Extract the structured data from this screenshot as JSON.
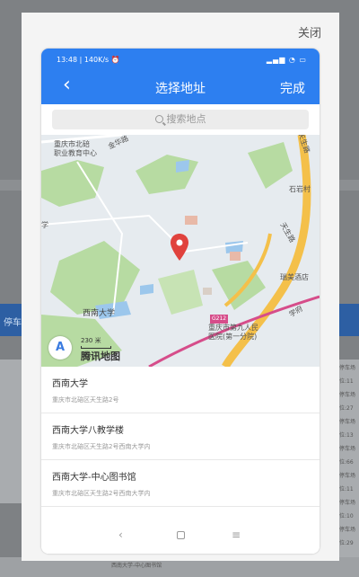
{
  "modal": {
    "close_label": "关闭"
  },
  "statusbar": {
    "time": "13:48 | 140K/s ⏰",
    "signal": "▂▄▆ ◔ ▭"
  },
  "navbar": {
    "back_icon": "‹",
    "title": "选择地址",
    "done_label": "完成"
  },
  "search": {
    "placeholder": "搜索地点"
  },
  "map": {
    "labels": {
      "school1": "重庆市北碚",
      "school2": "职业教育中心",
      "jinsheng": "金华路",
      "tiansheng1": "天生路",
      "shiyan": "石岩村",
      "tiansheng2": "天生路",
      "rui": "瑞美酒店",
      "univ": "西南大学",
      "hospital1": "重庆市第九人民",
      "hospital2": "医院(第一分院)",
      "road_badge": "G212",
      "xuemei": "学府",
      "xiao": "学",
      "scale": "230 米",
      "logo": "腾讯地图",
      "compass": "A"
    },
    "colors": {
      "water": "#9cc7ec",
      "green": "#b7dba2",
      "road": "#f4c04a",
      "road_line": "#d64d8a",
      "pin": "#e0423d"
    }
  },
  "results": [
    {
      "name": "西南大学",
      "address": "重庆市北碚区天生路2号"
    },
    {
      "name": "西南大学八教学楼",
      "address": "重庆市北碚区天生路2号西南大学内"
    },
    {
      "name": "西南大学-中心图书馆",
      "address": "重庆市北碚区天生路2号西南大学内"
    }
  ],
  "sysnav": {
    "back": "‹",
    "menu": "≡"
  },
  "background": {
    "band_label": "停车",
    "bottom_label": "西南大学-中心图书馆",
    "right_items": [
      "停车场",
      "位:11",
      "停车场",
      "位:27",
      "停车场",
      "位:13",
      "停车场",
      "位:66",
      "停车场",
      "位:11",
      "停车场",
      "位:10",
      "停车场",
      "位:29"
    ]
  }
}
